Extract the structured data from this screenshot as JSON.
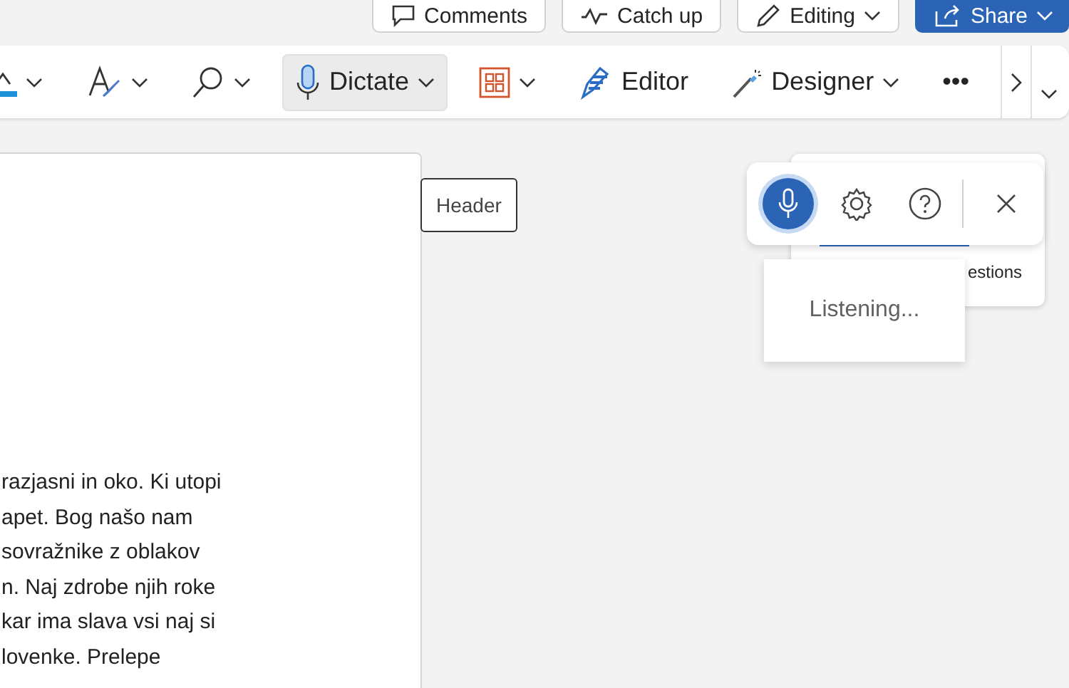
{
  "top_buttons": [
    {
      "label": "Comments",
      "kind": "comment"
    },
    {
      "label": "Catch up",
      "kind": "pulse"
    },
    {
      "label": "Editing",
      "kind": "pencil"
    },
    {
      "label": "Share",
      "kind": "share"
    }
  ],
  "ribbon": {
    "items": [
      {
        "dropdown": true,
        "selected": false
      },
      {
        "dropdown": true,
        "selected": false
      },
      {
        "dropdown": true,
        "selected": false
      },
      {
        "label": "Dictate",
        "dropdown": true,
        "selected": true
      },
      {
        "dropdown": true,
        "selected": false
      },
      {
        "label": "Editor",
        "dropdown": false,
        "selected": false
      },
      {
        "label": "Designer",
        "dropdown": true,
        "selected": false
      },
      {
        "label": "•••",
        "dropdown": false,
        "selected": false
      }
    ]
  },
  "document": {
    "lines": [
      "razjasni in oko. Ki utopi",
      "apet. Bog našo nam",
      "sovražnike z oblakov",
      "n. Naj zdrobe njih roke",
      "kar ima slava vsi naj si",
      "lovenke. Prelepe"
    ],
    "header_tag": "Header"
  },
  "suggestions_card": {
    "text": "estions"
  },
  "dictation_toolbar": {
    "listening": true,
    "status": "Listening..."
  }
}
